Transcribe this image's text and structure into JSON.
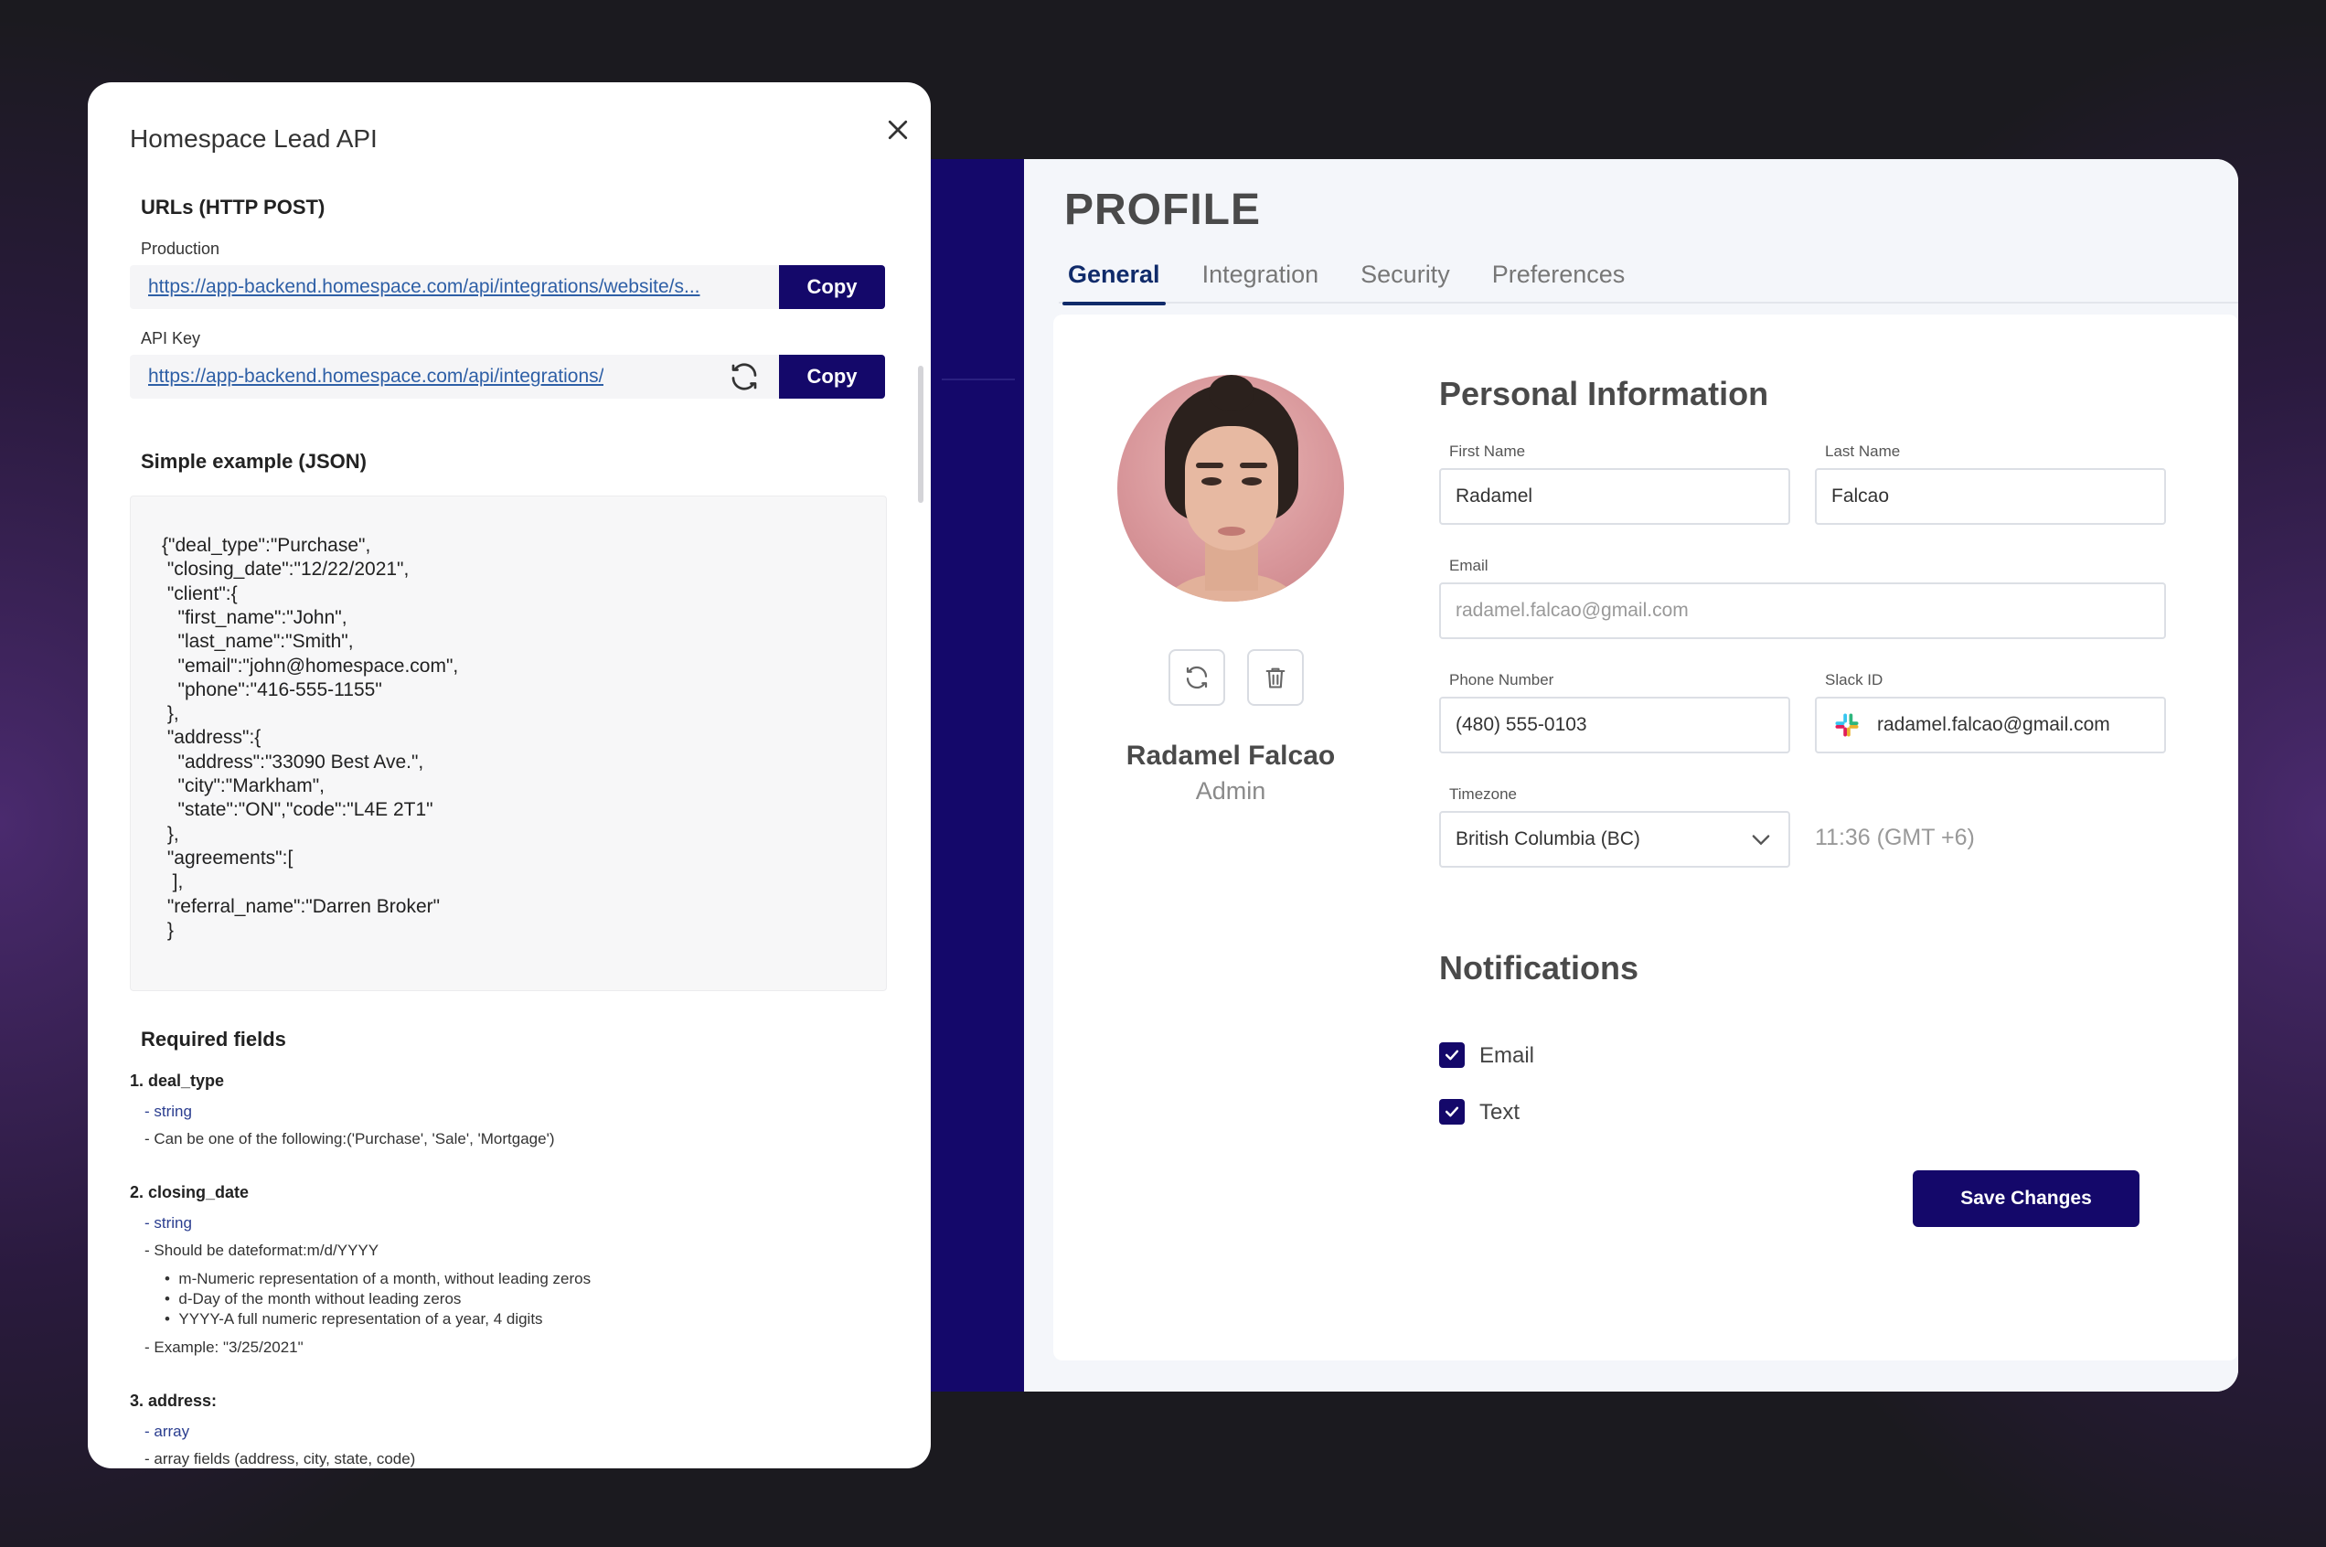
{
  "profile": {
    "title": "PROFILE",
    "tabs": [
      "General",
      "Integration",
      "Security",
      "Preferences"
    ],
    "user": {
      "name": "Radamel Falcao",
      "role": "Admin"
    },
    "personal_info": {
      "heading": "Personal Information",
      "first_name_label": "First Name",
      "first_name": "Radamel",
      "last_name_label": "Last Name",
      "last_name": "Falcao",
      "email_label": "Email",
      "email": "radamel.falcao@gmail.com",
      "phone_label": "Phone Number",
      "phone": "(480) 555-0103",
      "slack_label": "Slack ID",
      "slack": "radamel.falcao@gmail.com",
      "timezone_label": "Timezone",
      "timezone": "British Columbia (BC)",
      "timezone_time": "11:36 (GMT +6)"
    },
    "notifications": {
      "heading": "Notifications",
      "email_label": "Email",
      "email_checked": true,
      "text_label": "Text",
      "text_checked": true
    },
    "save_label": "Save Changes",
    "accent": "#14086a"
  },
  "modal": {
    "title": "Homespace Lead API",
    "urls_heading": "URLs (HTTP POST)",
    "production_label": "Production",
    "production_url": "https://app-backend.homespace.com/api/integrations/website/s...",
    "api_key_label": "API Key",
    "api_key_url": "https://app-backend.homespace.com/api/integrations/",
    "copy_label": "Copy",
    "example_heading": "Simple example (JSON)",
    "json_lines": [
      "{\"deal_type\":\"Purchase\",",
      " \"closing_date\":\"12/22/2021\",",
      " \"client\":{",
      "   \"first_name\":\"John\",",
      "   \"last_name\":\"Smith\",",
      "   \"email\":\"john@homespace.com\",",
      "   \"phone\":\"416-555-1155\"",
      " },",
      " \"address\":{",
      "   \"address\":\"33090 Best Ave.\",",
      "   \"city\":\"Markham\",",
      "   \"state\":\"ON\",\"code\":\"L4E 2T1\"",
      " },",
      " \"agreements\":[",
      "  ],",
      " \"referral_name\":\"Darren Broker\"",
      " }"
    ],
    "required_heading": "Required fields",
    "required": [
      {
        "name": "1. deal_type",
        "type": "- string",
        "desc": "- Can be one of the following:('Purchase', 'Sale', 'Mortgage')"
      },
      {
        "name": "2. closing_date",
        "type": "- string",
        "desc": "- Should be dateformat:m/d/YYYY",
        "bullets": [
          "m-Numeric representation of a month, without leading zeros",
          "d-Day of the month without leading zeros",
          "YYYY-A full numeric representation of a year, 4 digits"
        ],
        "example": "- Example: \"3/25/2021\""
      },
      {
        "name": "3. address:",
        "type": "- array",
        "desc": "- array fields (address, city, state, code)"
      }
    ]
  }
}
